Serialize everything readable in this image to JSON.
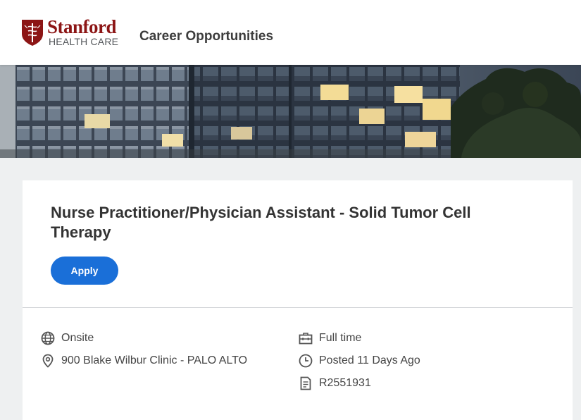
{
  "header": {
    "logo": {
      "line1": "Stanford",
      "line2": "HEALTH CARE"
    },
    "site_title": "Career Opportunities"
  },
  "job": {
    "title": "Nurse Practitioner/Physician Assistant - Solid Tumor Cell Therapy",
    "apply_label": "Apply",
    "details": {
      "workplace": "Onsite",
      "location": "900 Blake Wilbur Clinic - PALO ALTO",
      "time_type": "Full time",
      "posted": "Posted 11 Days Ago",
      "requisition_id": "R2551931"
    },
    "icons": {
      "workplace": "globe-icon",
      "location": "location-pin-icon",
      "time_type": "briefcase-icon",
      "posted": "clock-icon",
      "requisition_id": "document-icon"
    }
  },
  "colors": {
    "brand": "#8c1515",
    "accent": "#1a6fd8",
    "background": "#eef0f1"
  }
}
